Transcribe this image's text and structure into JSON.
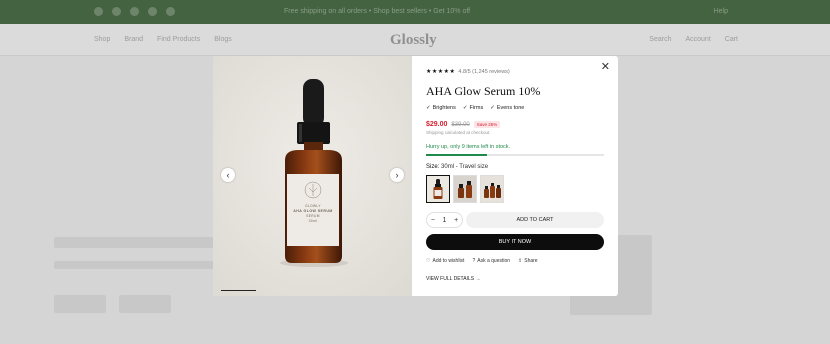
{
  "background": {
    "announcement": {
      "message": "Free shipping on all orders • Shop best sellers • Get 10% off",
      "right_text": "Help"
    },
    "header": {
      "nav": [
        "Shop",
        "Brand",
        "Find Products",
        "Blogs"
      ],
      "logo": "Glossly",
      "actions": [
        "Search",
        "Account",
        "Cart"
      ]
    }
  },
  "modal": {
    "close_icon": "close-icon",
    "media": {
      "prev_icon": "chevron-left-icon",
      "next_icon": "chevron-right-icon",
      "bottle_label_lines": [
        "GLOWLY",
        "AHA GLOW SERUM",
        "SERUM",
        "30ml"
      ],
      "slide_progress": 0.18
    },
    "product": {
      "stars": "★★★★★",
      "rating_text": "4.8/5 (1,245 reviews)",
      "title": "AHA Glow Serum 10%",
      "features": [
        "Brightens",
        "Firms",
        "Evens tone"
      ],
      "price": "$29.00",
      "compare_price": "$39.00",
      "save_badge": "Save 25%",
      "shipping_note": "Shipping calculated at checkout.",
      "stock_message": "Hurry up, only 9 items left in stock.",
      "stock_fraction": 0.34,
      "size_label": "Size:",
      "size_value": "30ml - Travel size",
      "quantity": "1",
      "minus": "−",
      "plus": "+",
      "add_to_cart": "ADD TO CART",
      "buy_now": "BUY IT NOW",
      "links": [
        "Add to wishlist",
        "Ask a question",
        "Share"
      ],
      "view_details": "VIEW FULL DETAILS →"
    }
  },
  "colors": {
    "announcement_bg": "#214d1d",
    "price": "#d5212f",
    "stock": "#1f8a4c",
    "buy_bg": "#0d0d0d"
  }
}
